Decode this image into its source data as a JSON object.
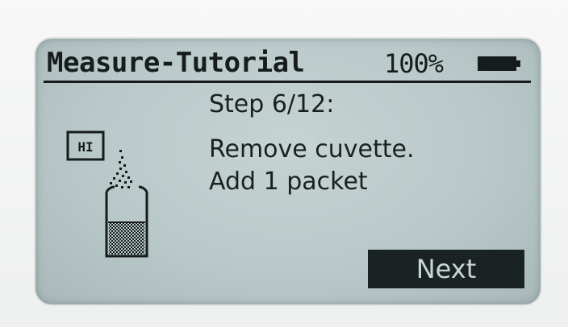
{
  "header": {
    "title": "Measure-Tutorial",
    "battery_percent": "100%",
    "battery_icon": "battery-full-icon"
  },
  "step": {
    "label": "Step 6/12:",
    "instruction_line1": "Remove cuvette.",
    "instruction_line2": "Add 1 packet"
  },
  "illustration": {
    "icon": "reagent-packet-into-cuvette-icon",
    "packet_label": "HI"
  },
  "buttons": {
    "next_label": "Next"
  },
  "colors": {
    "lcd_background": "#bccaca",
    "lcd_ink": "#161c1c",
    "button_background": "#1b2222",
    "button_text": "#c9d6d6"
  }
}
